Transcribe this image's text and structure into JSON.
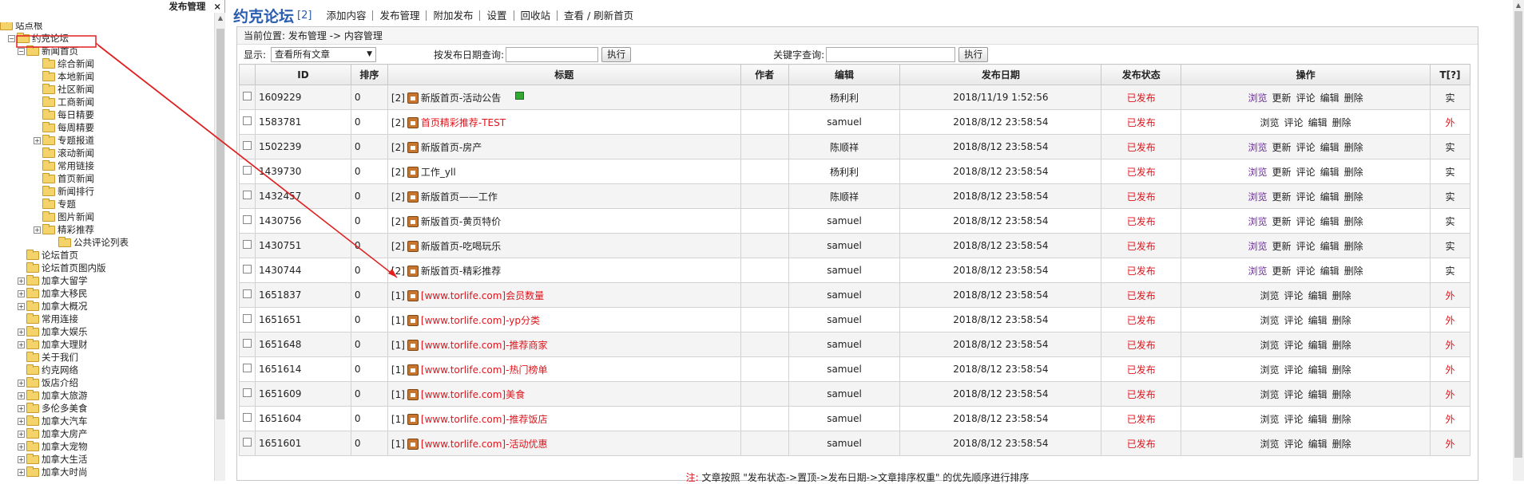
{
  "left_panel": {
    "header_title": "发布管理",
    "close_label": "×",
    "tree": [
      {
        "label": "站点根",
        "level": 0,
        "expander": "",
        "selected": false
      },
      {
        "label": "约克论坛",
        "level": 1,
        "expander": "⊟",
        "selected": true
      },
      {
        "label": "新闻首页",
        "level": 2,
        "expander": "⊟",
        "selected": false
      },
      {
        "label": "综合新闻",
        "level": 3,
        "expander": "",
        "selected": false
      },
      {
        "label": "本地新闻",
        "level": 3,
        "expander": "",
        "selected": false
      },
      {
        "label": "社区新闻",
        "level": 3,
        "expander": "",
        "selected": false
      },
      {
        "label": "工商新闻",
        "level": 3,
        "expander": "",
        "selected": false
      },
      {
        "label": "每日精要",
        "level": 3,
        "expander": "",
        "selected": false
      },
      {
        "label": "每周精要",
        "level": 3,
        "expander": "",
        "selected": false
      },
      {
        "label": "专题报道",
        "level": 3,
        "expander": "⊞",
        "selected": false
      },
      {
        "label": "滚动新闻",
        "level": 3,
        "expander": "",
        "selected": false
      },
      {
        "label": "常用链接",
        "level": 3,
        "expander": "",
        "selected": false
      },
      {
        "label": "首页新闻",
        "level": 3,
        "expander": "",
        "selected": false
      },
      {
        "label": "新闻排行",
        "level": 3,
        "expander": "",
        "selected": false
      },
      {
        "label": "专题",
        "level": 3,
        "expander": "",
        "selected": false
      },
      {
        "label": "图片新闻",
        "level": 3,
        "expander": "",
        "selected": false
      },
      {
        "label": "精彩推荐",
        "level": 3,
        "expander": "⊞",
        "selected": false
      },
      {
        "label": "公共评论列表",
        "level": 4,
        "expander": "",
        "selected": false
      },
      {
        "label": "论坛首页",
        "level": 2,
        "expander": "",
        "selected": false
      },
      {
        "label": "论坛首页图内版",
        "level": 2,
        "expander": "",
        "selected": false
      },
      {
        "label": "加拿大留学",
        "level": 2,
        "expander": "⊞",
        "selected": false
      },
      {
        "label": "加拿大移民",
        "level": 2,
        "expander": "⊞",
        "selected": false
      },
      {
        "label": "加拿大概况",
        "level": 2,
        "expander": "⊞",
        "selected": false
      },
      {
        "label": "常用连接",
        "level": 2,
        "expander": "",
        "selected": false
      },
      {
        "label": "加拿大娱乐",
        "level": 2,
        "expander": "⊞",
        "selected": false
      },
      {
        "label": "加拿大理财",
        "level": 2,
        "expander": "⊞",
        "selected": false
      },
      {
        "label": "关于我们",
        "level": 2,
        "expander": "",
        "selected": false
      },
      {
        "label": "约克网络",
        "level": 2,
        "expander": "",
        "selected": false
      },
      {
        "label": "饭店介绍",
        "level": 2,
        "expander": "⊞",
        "selected": false
      },
      {
        "label": "加拿大旅游",
        "level": 2,
        "expander": "⊞",
        "selected": false
      },
      {
        "label": "多伦多美食",
        "level": 2,
        "expander": "⊞",
        "selected": false
      },
      {
        "label": "加拿大汽车",
        "level": 2,
        "expander": "⊞",
        "selected": false
      },
      {
        "label": "加拿大房产",
        "level": 2,
        "expander": "⊞",
        "selected": false
      },
      {
        "label": "加拿大宠物",
        "level": 2,
        "expander": "⊞",
        "selected": false
      },
      {
        "label": "加拿大生活",
        "level": 2,
        "expander": "⊞",
        "selected": false
      },
      {
        "label": "加拿大时尚",
        "level": 2,
        "expander": "⊞",
        "selected": false
      }
    ]
  },
  "top": {
    "title": "约克论坛",
    "count": "[2]",
    "nav": [
      "添加内容",
      "发布管理",
      "附加发布",
      "设置",
      "回收站",
      "查看 /  刷新首页"
    ]
  },
  "breadcrumb": "当前位置: 发布管理 -> 内容管理",
  "filters": {
    "show_label": "显示:",
    "show_value": "查看所有文章",
    "date_label": "按发布日期查询:",
    "exec_label": "执行",
    "keyword_label": "关键字查询:"
  },
  "table": {
    "headers": [
      "",
      "ID",
      "排序",
      "标题",
      "作者",
      "编辑",
      "发布日期",
      "发布状态",
      "操作",
      "T[?]"
    ],
    "rows": [
      {
        "id": "1609229",
        "order": "0",
        "prefix": "[2]",
        "title": "新版首页-活动公告",
        "title_red": false,
        "flag": true,
        "author": "",
        "editor": "杨利利",
        "date": "2018/11/19 1:52:56",
        "status": "已发布",
        "ops": [
          "浏览",
          "更新",
          "评论",
          "编辑",
          "删除"
        ],
        "t": "实"
      },
      {
        "id": "1583781",
        "order": "0",
        "prefix": "[2]",
        "title": "首页精彩推荐-TEST",
        "title_red": true,
        "flag": false,
        "author": "",
        "editor": "samuel",
        "date": "2018/8/12 23:58:54",
        "status": "已发布",
        "ops": [
          "浏览",
          "评论",
          "编辑",
          "删除"
        ],
        "t": "外"
      },
      {
        "id": "1502239",
        "order": "0",
        "prefix": "[2]",
        "title": "新版首页-房产",
        "title_red": false,
        "flag": false,
        "author": "",
        "editor": "陈顺祥",
        "date": "2018/8/12 23:58:54",
        "status": "已发布",
        "ops": [
          "浏览",
          "更新",
          "评论",
          "编辑",
          "删除"
        ],
        "t": "实"
      },
      {
        "id": "1439730",
        "order": "0",
        "prefix": "[2]",
        "title": "工作_yll",
        "title_red": false,
        "flag": false,
        "author": "",
        "editor": "杨利利",
        "date": "2018/8/12 23:58:54",
        "status": "已发布",
        "ops": [
          "浏览",
          "更新",
          "评论",
          "编辑",
          "删除"
        ],
        "t": "实"
      },
      {
        "id": "1432457",
        "order": "0",
        "prefix": "[2]",
        "title": "新版首页——工作",
        "title_red": false,
        "flag": false,
        "author": "",
        "editor": "陈顺祥",
        "date": "2018/8/12 23:58:54",
        "status": "已发布",
        "ops": [
          "浏览",
          "更新",
          "评论",
          "编辑",
          "删除"
        ],
        "t": "实"
      },
      {
        "id": "1430756",
        "order": "0",
        "prefix": "[2]",
        "title": "新版首页-黄页特价",
        "title_red": false,
        "flag": false,
        "author": "",
        "editor": "samuel",
        "date": "2018/8/12 23:58:54",
        "status": "已发布",
        "ops": [
          "浏览",
          "更新",
          "评论",
          "编辑",
          "删除"
        ],
        "t": "实"
      },
      {
        "id": "1430751",
        "order": "0",
        "prefix": "[2]",
        "title": "新版首页-吃喝玩乐",
        "title_red": false,
        "flag": false,
        "author": "",
        "editor": "samuel",
        "date": "2018/8/12 23:58:54",
        "status": "已发布",
        "ops": [
          "浏览",
          "更新",
          "评论",
          "编辑",
          "删除"
        ],
        "t": "实"
      },
      {
        "id": "1430744",
        "order": "0",
        "prefix": "[2]",
        "title": "新版首页-精彩推荐",
        "title_red": false,
        "flag": false,
        "author": "",
        "editor": "samuel",
        "date": "2018/8/12 23:58:54",
        "status": "已发布",
        "ops": [
          "浏览",
          "更新",
          "评论",
          "编辑",
          "删除"
        ],
        "t": "实"
      },
      {
        "id": "1651837",
        "order": "0",
        "prefix": "[1]",
        "title": "[www.torlife.com]会员数量",
        "title_red": true,
        "flag": false,
        "author": "",
        "editor": "samuel",
        "date": "2018/8/12 23:58:54",
        "status": "已发布",
        "ops": [
          "浏览",
          "评论",
          "编辑",
          "删除"
        ],
        "t": "外"
      },
      {
        "id": "1651651",
        "order": "0",
        "prefix": "[1]",
        "title": "[www.torlife.com]-yp分类",
        "title_red": true,
        "flag": false,
        "author": "",
        "editor": "samuel",
        "date": "2018/8/12 23:58:54",
        "status": "已发布",
        "ops": [
          "浏览",
          "评论",
          "编辑",
          "删除"
        ],
        "t": "外"
      },
      {
        "id": "1651648",
        "order": "0",
        "prefix": "[1]",
        "title": "[www.torlife.com]-推荐商家",
        "title_red": true,
        "flag": false,
        "author": "",
        "editor": "samuel",
        "date": "2018/8/12 23:58:54",
        "status": "已发布",
        "ops": [
          "浏览",
          "评论",
          "编辑",
          "删除"
        ],
        "t": "外"
      },
      {
        "id": "1651614",
        "order": "0",
        "prefix": "[1]",
        "title": "[www.torlife.com]-热门榜单",
        "title_red": true,
        "flag": false,
        "author": "",
        "editor": "samuel",
        "date": "2018/8/12 23:58:54",
        "status": "已发布",
        "ops": [
          "浏览",
          "评论",
          "编辑",
          "删除"
        ],
        "t": "外"
      },
      {
        "id": "1651609",
        "order": "0",
        "prefix": "[1]",
        "title": "[www.torlife.com]美食",
        "title_red": true,
        "flag": false,
        "author": "",
        "editor": "samuel",
        "date": "2018/8/12 23:58:54",
        "status": "已发布",
        "ops": [
          "浏览",
          "评论",
          "编辑",
          "删除"
        ],
        "t": "外"
      },
      {
        "id": "1651604",
        "order": "0",
        "prefix": "[1]",
        "title": "[www.torlife.com]-推荐饭店",
        "title_red": true,
        "flag": false,
        "author": "",
        "editor": "samuel",
        "date": "2018/8/12 23:58:54",
        "status": "已发布",
        "ops": [
          "浏览",
          "评论",
          "编辑",
          "删除"
        ],
        "t": "外"
      },
      {
        "id": "1651601",
        "order": "0",
        "prefix": "[1]",
        "title": "[www.torlife.com]-活动优惠",
        "title_red": true,
        "flag": false,
        "author": "",
        "editor": "samuel",
        "date": "2018/8/12 23:58:54",
        "status": "已发布",
        "ops": [
          "浏览",
          "评论",
          "编辑",
          "删除"
        ],
        "t": "外"
      }
    ]
  },
  "note": {
    "prefix": "注:",
    "text": "文章按照 \"发布状态->置顶->发布日期->文章排序权重\" 的优先顺序进行排序"
  },
  "colors": {
    "accent": "#2a5db0",
    "status_red": "#e0141c",
    "link_purple": "#6a2a99",
    "annotation_red": "#e02020"
  }
}
